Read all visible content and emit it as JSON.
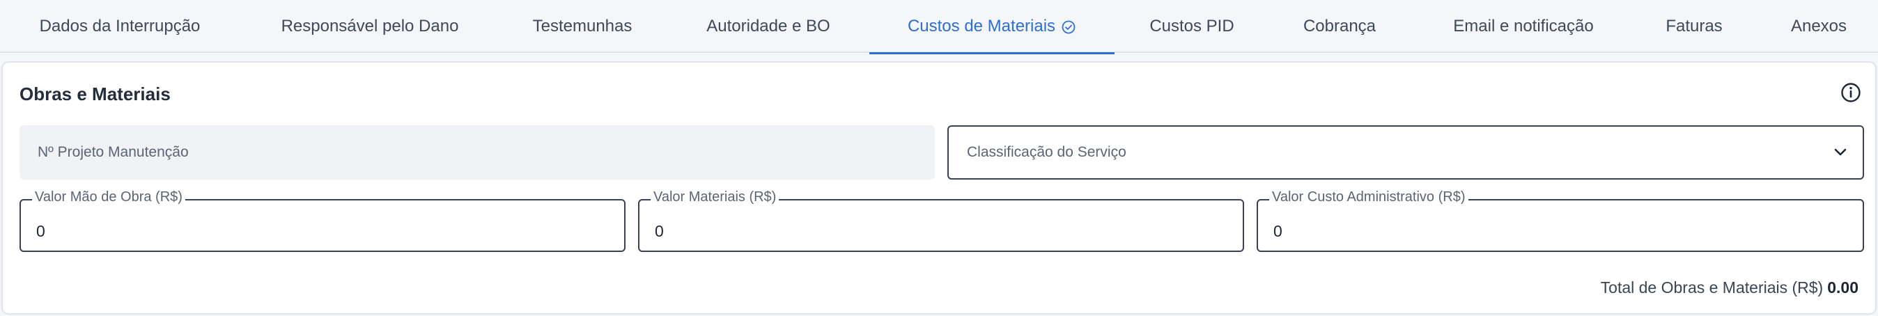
{
  "tabs": [
    {
      "label": "Dados da Interrupção"
    },
    {
      "label": "Responsável pelo Dano"
    },
    {
      "label": "Testemunhas"
    },
    {
      "label": "Autoridade e BO"
    },
    {
      "label": "Custos de Materiais",
      "active": true,
      "status_icon": "check-circle-icon"
    },
    {
      "label": "Custos PID"
    },
    {
      "label": "Cobrança"
    },
    {
      "label": "Email e notificação"
    },
    {
      "label": "Faturas"
    },
    {
      "label": "Anexos"
    }
  ],
  "colors": {
    "accent": "#2e6fd1",
    "border": "#3a4252",
    "disabled_bg": "#f0f2f6"
  },
  "section": {
    "title": "Obras e Materiais",
    "info_icon": "info-icon",
    "project_number": {
      "placeholder": "Nº Projeto Manutenção"
    },
    "service_classification": {
      "placeholder": "Classificação do Serviço",
      "icon": "chevron-down-icon"
    },
    "labor_value": {
      "label": "Valor Mão de Obra (R$)",
      "value": "0"
    },
    "materials_value": {
      "label": "Valor Materiais (R$)",
      "value": "0"
    },
    "admin_cost_value": {
      "label": "Valor Custo Administrativo (R$)",
      "value": "0"
    },
    "total": {
      "label": "Total de Obras e Materiais (R$)",
      "value": "0.00"
    }
  }
}
